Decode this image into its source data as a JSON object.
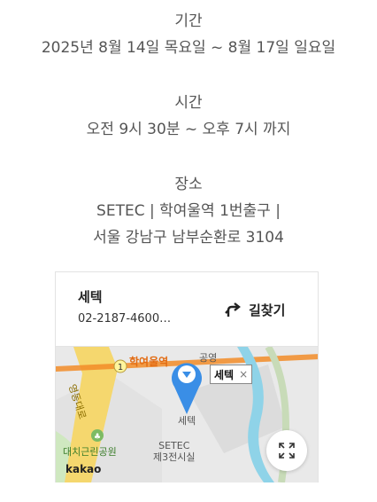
{
  "event": {
    "period_label": "기간",
    "period_value": "2025년 8월 14일 목요일 ~ 8월 17일 일요일",
    "time_label": "시간",
    "time_value": "오전 9시 30분 ~ 오후 7시 까지",
    "place_label": "장소",
    "place_line1": "SETEC | 학여울역 1번출구 |",
    "place_line2": "서울 강남구 남부순환로 3104"
  },
  "map_card": {
    "name": "세텍",
    "phone": "02-2187-4600…",
    "directions_label": "길찾기",
    "directions_icon": "turn-right-arrow-icon",
    "expand_icon": "fullscreen-expand-icon",
    "map": {
      "station_label": "학여울역",
      "park_label": "공영",
      "building_label": "세텍",
      "venue_label_line1": "SETEC",
      "venue_label_line2": "제3전시실",
      "park2_label": "대치근린공원",
      "road_label": "영동대로",
      "subway_number": "1",
      "pin_tag_label": "세텍",
      "pin_tag_close": "×",
      "provider_logo": "kakao",
      "road_color": "#f5d76e",
      "subway_color": "#f28c28",
      "water_color": "#8fd3e8",
      "park_color": "#cfe8c0",
      "pin_color": "#3a8ee6"
    }
  }
}
